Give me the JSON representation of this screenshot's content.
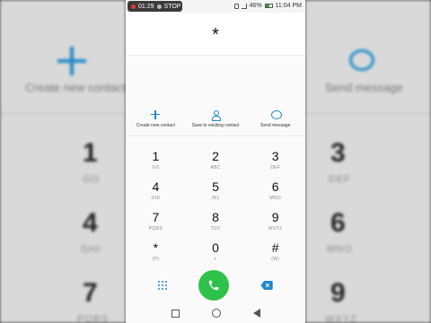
{
  "status_bar": {
    "recording_time": "01:29",
    "stop_label": "STOP",
    "battery": "46%",
    "clock": "11:04 PM"
  },
  "dialer": {
    "entered_number": "*"
  },
  "actions": [
    {
      "label": "Create new contact",
      "icon": "add-contact-icon"
    },
    {
      "label": "Save to existing contact",
      "icon": "person-icon"
    },
    {
      "label": "Send message",
      "icon": "message-bubble-icon"
    }
  ],
  "keypad": [
    [
      {
        "digit": "1",
        "letters": "GO"
      },
      {
        "digit": "2",
        "letters": "ABC"
      },
      {
        "digit": "3",
        "letters": "DEF"
      }
    ],
    [
      {
        "digit": "4",
        "letters": "GHI"
      },
      {
        "digit": "5",
        "letters": "JKL"
      },
      {
        "digit": "6",
        "letters": "MNO"
      }
    ],
    [
      {
        "digit": "7",
        "letters": "PQRS"
      },
      {
        "digit": "8",
        "letters": "TUV"
      },
      {
        "digit": "9",
        "letters": "WXYZ"
      }
    ],
    [
      {
        "digit": "*",
        "letters": "(P)"
      },
      {
        "digit": "0",
        "letters": "+"
      },
      {
        "digit": "#",
        "letters": "(W)"
      }
    ]
  ],
  "background": {
    "left_label": "Create new contact",
    "right_label": "Send message",
    "left_digits": [
      {
        "digit": "1",
        "letters": "GO"
      },
      {
        "digit": "4",
        "letters": "GHI"
      },
      {
        "digit": "7",
        "letters": "PQRS"
      }
    ],
    "right_digits": [
      {
        "digit": "3",
        "letters": "DEF"
      },
      {
        "digit": "6",
        "letters": "MNO"
      },
      {
        "digit": "9",
        "letters": "WXYZ"
      }
    ]
  },
  "colors": {
    "accent": "#1e88c8",
    "call_green": "#2ec24a",
    "record_red": "#e53935"
  }
}
